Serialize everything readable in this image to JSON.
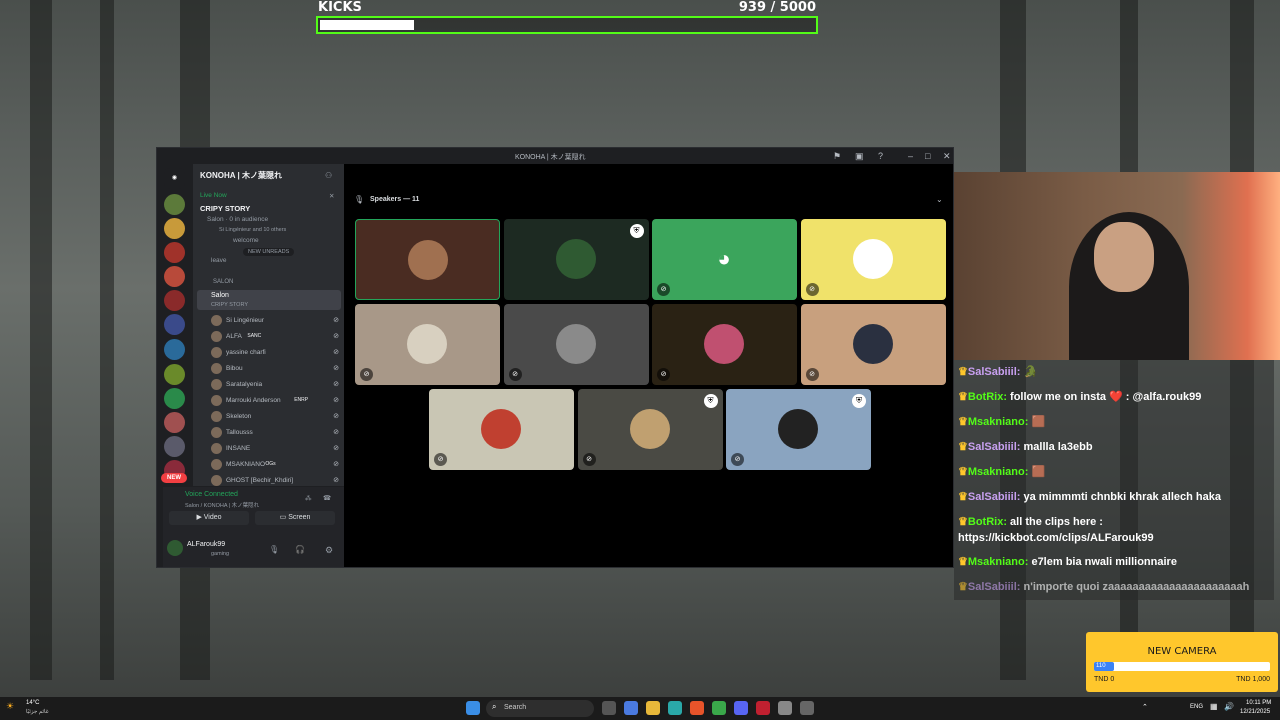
{
  "kicks_goal": {
    "label": "KICKS",
    "count_text": "939  / 5000",
    "current": 939,
    "target": 5000
  },
  "discord": {
    "window_title": "KONOHA | 木ノ葉隠れ",
    "server_name": "KONOHA | 木ノ葉隠れ",
    "live_badge": "Live Now",
    "event_title": "CRIPY STORY",
    "event_meta": "Salon · 0 in audience",
    "event_members": "Si Lingénieur and 10 others",
    "welcome_channel": "welcome",
    "new_unreads": "NEW UNREADS",
    "leave_channel": "leave",
    "category": "SALON",
    "stage_channel": "Salon",
    "stage_topic": "CRIPY STORY",
    "members": [
      {
        "name": "Si Lingénieur"
      },
      {
        "name": "ALFA",
        "tag": "SANC"
      },
      {
        "name": "yassine charfi"
      },
      {
        "name": "Bibou"
      },
      {
        "name": "Saratalyenia"
      },
      {
        "name": "Marrouki Anderson",
        "tag": "ENRP"
      },
      {
        "name": "Skeleton"
      },
      {
        "name": "Tallousss"
      },
      {
        "name": "INSANE"
      },
      {
        "name": "MSAKNIANO",
        "tag": "OGs"
      },
      {
        "name": "GHOST [Bechir_Khdiri]"
      }
    ],
    "voice_status": "Voice Connected",
    "voice_channel": "Salon / KONOHA | 木ノ葉隠れ",
    "video_button": "Video",
    "screen_button": "Screen",
    "user_name": "ALFarouk99",
    "user_status": "gaming",
    "speakers_header": "Speakers — 11",
    "new_badge": "NEW",
    "tiles": [
      {
        "bg": "#4a2c22",
        "avatar": "#a07050",
        "muted": false,
        "mod": false,
        "speaking": true
      },
      {
        "bg": "#1d2a22",
        "avatar": "#2f5a32",
        "muted": false,
        "mod": true
      },
      {
        "bg": "#3ba55c",
        "avatar": "#5865f2",
        "muted": true,
        "mod": false,
        "discord_logo": true
      },
      {
        "bg": "#f0e26a",
        "avatar": "#ffffff",
        "muted": true,
        "mod": false
      },
      {
        "bg": "#a89888",
        "avatar": "#d8d0c0",
        "muted": true,
        "mod": false
      },
      {
        "bg": "#4a4a4a",
        "avatar": "#8a8a8a",
        "muted": true,
        "mod": false
      },
      {
        "bg": "#2a2214",
        "avatar": "#c05070",
        "muted": true,
        "mod": false
      },
      {
        "bg": "#c8a07e",
        "avatar": "#2a3040",
        "muted": true,
        "mod": false
      },
      {
        "bg": "#c9c6b4",
        "avatar": "#c04030",
        "muted": true,
        "mod": false
      },
      {
        "bg": "#4a4a44",
        "avatar": "#c0a070",
        "muted": true,
        "mod": true
      },
      {
        "bg": "#8aa4c0",
        "avatar": "#222",
        "muted": true,
        "mod": true
      }
    ]
  },
  "chat": [
    {
      "user": "SalSabiiil:",
      "user_color": "#c8a0f0",
      "text": " 🐊"
    },
    {
      "user": "BotRix:",
      "user_color": "#53fc18",
      "text": " follow me on insta ❤️ : @alfa.rouk99"
    },
    {
      "user": "Msakniano:",
      "user_color": "#53fc18",
      "text": " 🟫"
    },
    {
      "user": "SalSabiiil:",
      "user_color": "#c8a0f0",
      "text": " mallla la3ebb"
    },
    {
      "user": "Msakniano:",
      "user_color": "#53fc18",
      "text": " 🟫"
    },
    {
      "user": "SalSabiiil:",
      "user_color": "#c8a0f0",
      "text": " ya mimmmti chnbki khrak allech haka"
    },
    {
      "user": "BotRix:",
      "user_color": "#53fc18",
      "text": " all the clips here : https://kickbot.com/clips/ALFarouk99"
    },
    {
      "user": "Msakniano:",
      "user_color": "#53fc18",
      "text": " e7lem bia nwali millionnaire"
    },
    {
      "user": "SalSabiiil:",
      "user_color": "#c8a0f0",
      "text": " n'importe quoi zaaaaaaaaaaaaaaaaaaaaaah"
    }
  ],
  "camera_goal": {
    "title": "NEW CAMERA",
    "progress_label": "110",
    "current": 110,
    "target": 1000,
    "min_label": "TND 0",
    "max_label": "TND 1,000"
  },
  "taskbar": {
    "weather_temp": "14°C",
    "weather_desc": "غائم جزئيًا",
    "search_placeholder": "Search",
    "lang": "ENG",
    "time": "10:11 PM",
    "date": "12/21/2025"
  }
}
